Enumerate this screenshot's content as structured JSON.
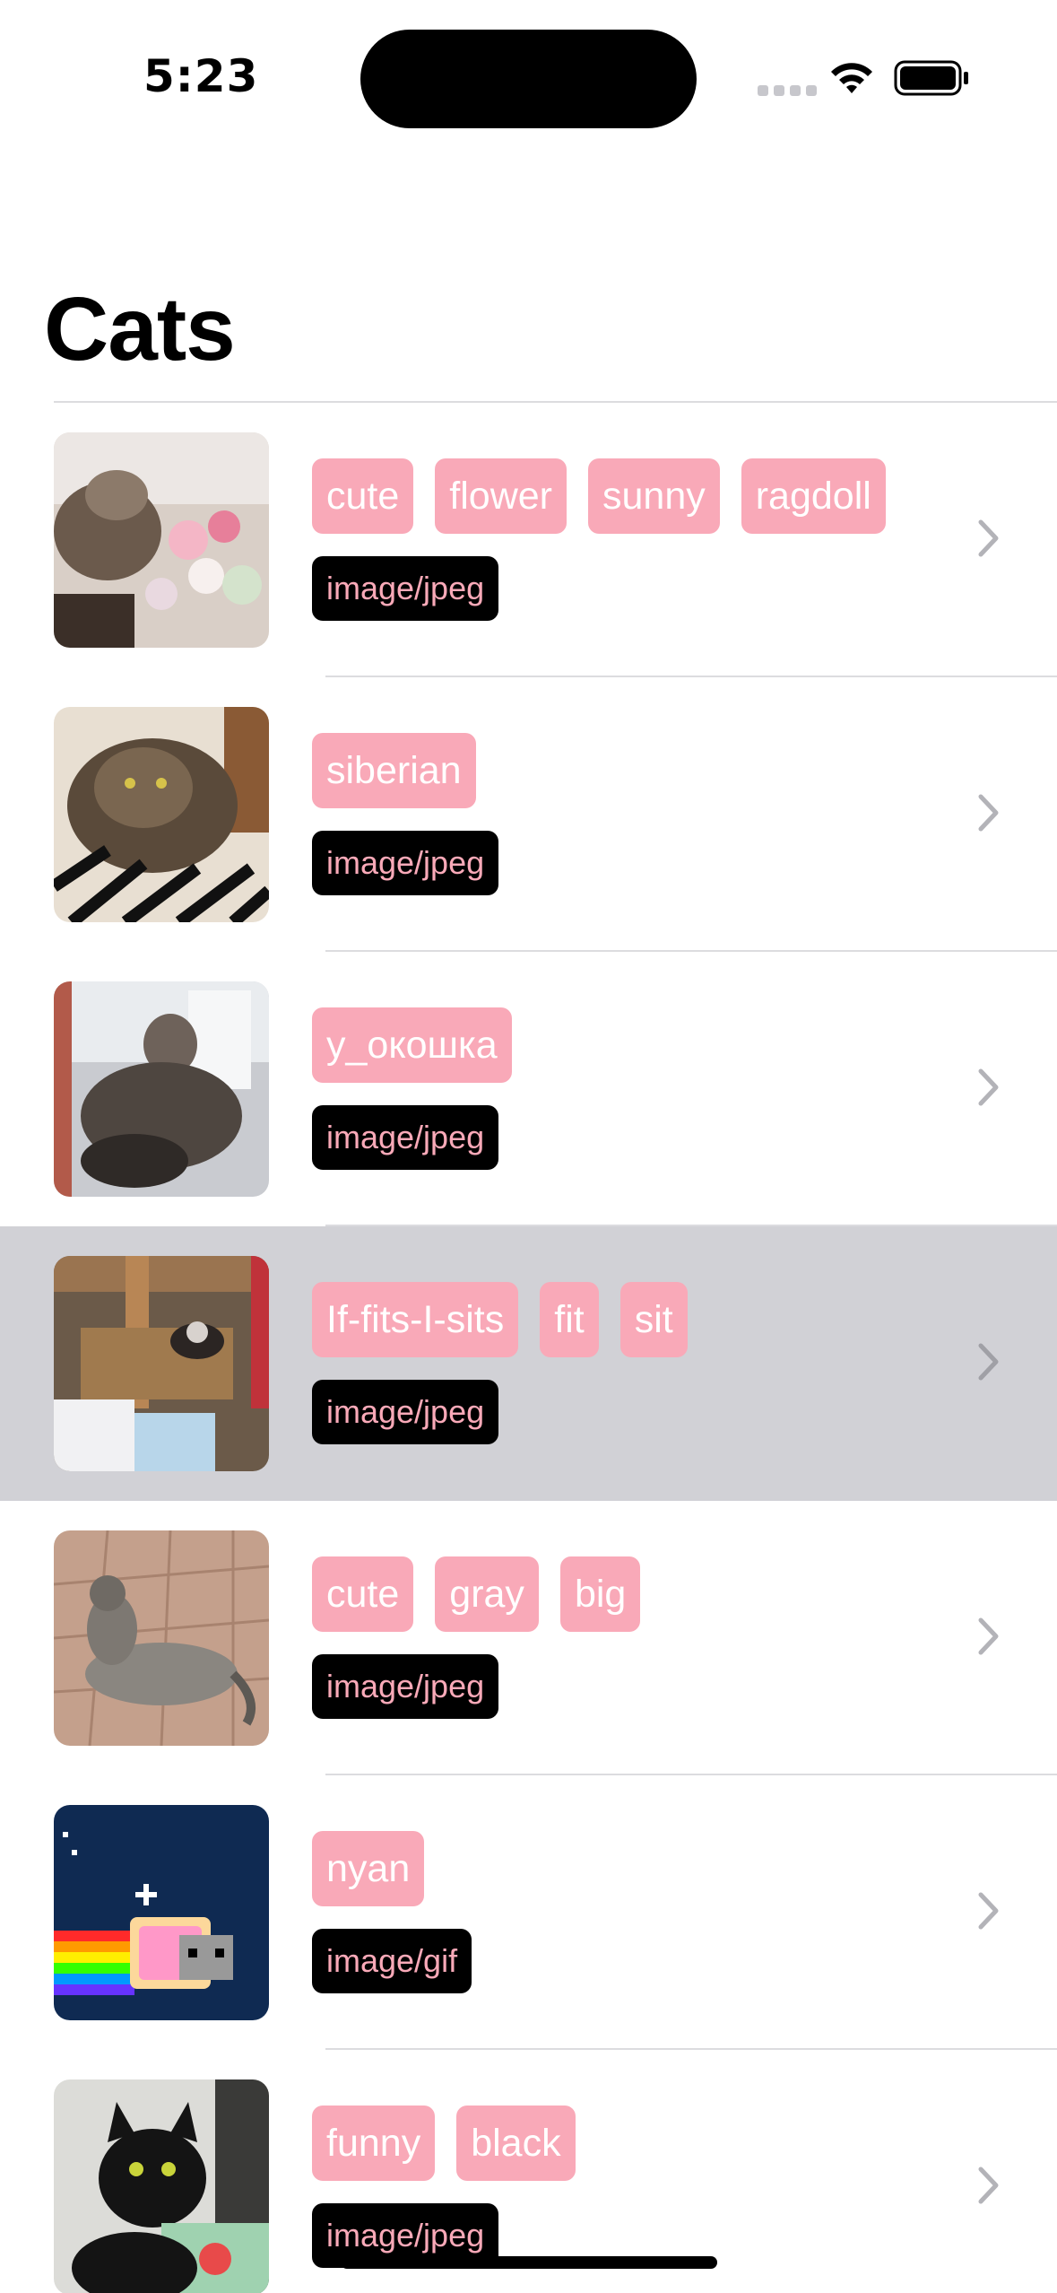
{
  "status_bar": {
    "time": "5:23"
  },
  "header": {
    "title": "Cats"
  },
  "cats": [
    {
      "tags": [
        "cute",
        "flower",
        "sunny",
        "ragdoll"
      ],
      "mime": "image/jpeg"
    },
    {
      "tags": [
        "siberian"
      ],
      "mime": "image/jpeg"
    },
    {
      "tags": [
        "у_окошка"
      ],
      "mime": "image/jpeg"
    },
    {
      "tags": [
        "If-fits-I-sits",
        "fit",
        "sit"
      ],
      "mime": "image/jpeg"
    },
    {
      "tags": [
        "cute",
        "gray",
        "big"
      ],
      "mime": "image/jpeg"
    },
    {
      "tags": [
        "nyan"
      ],
      "mime": "image/gif"
    },
    {
      "tags": [
        "funny",
        "black"
      ],
      "mime": "image/jpeg"
    }
  ],
  "colors": {
    "tag_bg": "#f9a9b8",
    "mime_bg": "#000000",
    "selected_row": "#d1d1d6"
  }
}
